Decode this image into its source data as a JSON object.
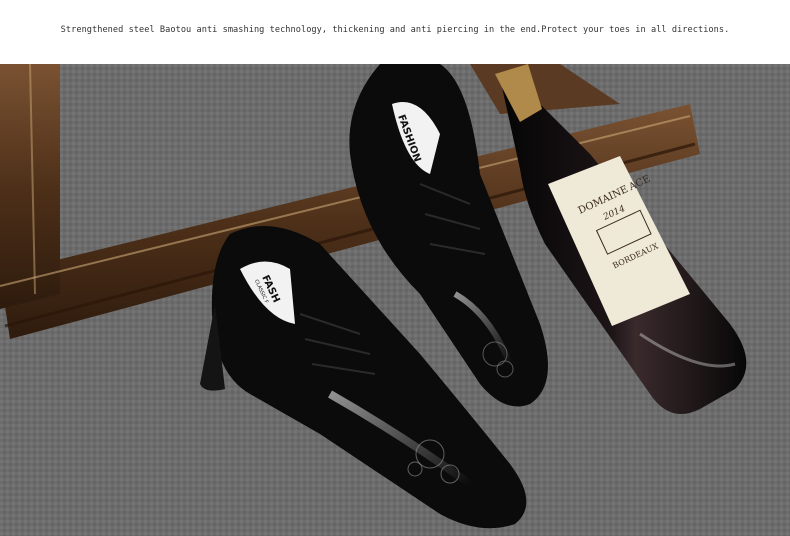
{
  "caption": "Strengthened steel Baotou anti smashing technology, thickening and anti piercing in the end.Protect your toes in all directions.",
  "photo": {
    "subject": "black patent leather lace-up shoes with embossed floral toe beside a wine bottle on a grey carpet with a wooden picture frame",
    "shoe_insole_brand": "FASHION",
    "shoe_insole_sub": "CLASSIC FASHION",
    "shoe_insole_brand_front": "FASH",
    "shoe_insole_sub_front": "CLASSIC F",
    "bottle_label_line1": "DOMAINE",
    "bottle_label_line2": "ACE",
    "bottle_label_year": "2014",
    "bottle_label_region": "BORDEAUX",
    "colors": {
      "carpet": "#6d6d6d",
      "frame": "#5a3a22",
      "leather": "#0b0b0b",
      "label": "#efe9d8",
      "capsule": "#b08a4a"
    }
  }
}
